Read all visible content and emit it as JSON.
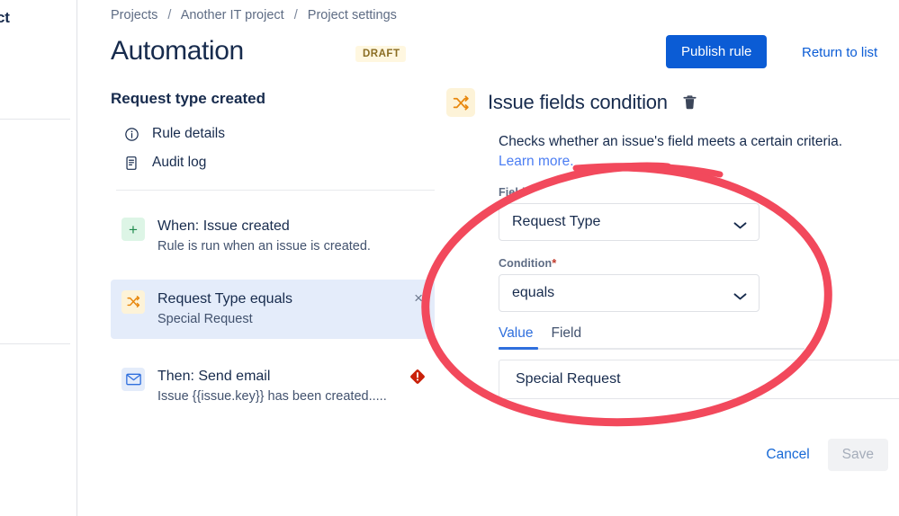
{
  "breadcrumb": {
    "items": [
      "Projects",
      "Another IT project",
      "Project settings"
    ],
    "separator": "/"
  },
  "farleft": {
    "truncated_label": "ct"
  },
  "header": {
    "title": "Automation",
    "badge": "DRAFT",
    "publish_label": "Publish rule",
    "return_label": "Return to list",
    "status_icon": "check-circle-icon",
    "colors": {
      "primary": "#0b5cd5",
      "link": "#0b5cd5",
      "success": "#1e7d52",
      "badge_bg": "#fff7e0",
      "badge_text": "#8a6d23"
    }
  },
  "rule_panel": {
    "heading": "Request type created",
    "nav": [
      {
        "label": "Rule details",
        "icon": "info-circle-icon"
      },
      {
        "label": "Audit log",
        "icon": "document-list-icon"
      }
    ],
    "components": [
      {
        "icon": "plus-icon",
        "icon_style": "green",
        "title": "When: Issue created",
        "subtitle": "Rule is run when an issue is created.",
        "selected": false,
        "close": false,
        "error": false
      },
      {
        "icon": "shuffle-icon",
        "icon_style": "orange",
        "title": "Request Type equals",
        "subtitle": "Special Request",
        "selected": true,
        "close": true,
        "close_glyph": "×",
        "error": false
      },
      {
        "icon": "envelope-icon",
        "icon_style": "blue",
        "title": "Then: Send email",
        "subtitle": "Issue {{issue.key}} has been created.....",
        "selected": false,
        "close": false,
        "error": true
      }
    ]
  },
  "detail": {
    "icon": "shuffle-icon",
    "title": "Issue fields condition",
    "delete_icon": "trash-icon",
    "description": "Checks whether an issue's field meets a certain criteria.",
    "learn_more": "Learn more.",
    "fields": {
      "field": {
        "label": "Field",
        "required_marker": "*",
        "value": "Request Type",
        "chevron": "chevron-down-icon"
      },
      "condition": {
        "label": "Condition",
        "required_marker": "*",
        "value": "equals",
        "chevron": "chevron-down-icon"
      }
    },
    "tabs": [
      {
        "label": "Value",
        "active": true
      },
      {
        "label": "Field",
        "active": false
      }
    ],
    "value_input": {
      "value": "Special Request",
      "placeholder": ""
    },
    "actions": {
      "cancel_label": "Cancel",
      "save_label": "Save",
      "save_disabled": true
    }
  },
  "annotation": {
    "type": "hand-drawn-ellipse",
    "color": "#f2495c",
    "description": "red circle highlighting the Field, Condition and Value inputs"
  }
}
